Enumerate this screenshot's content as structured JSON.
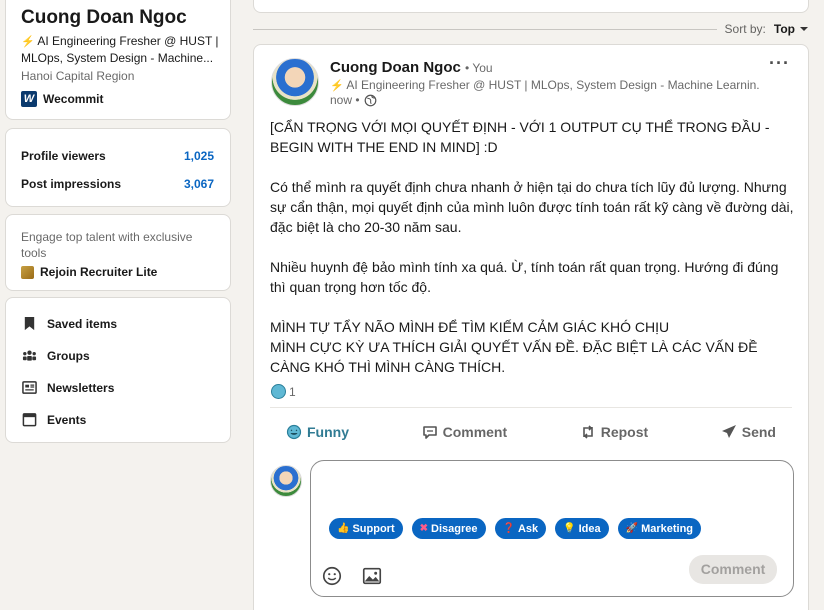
{
  "profile": {
    "name": "Cuong Doan Ngoc",
    "headline": "AI Engineering Fresher @ HUST | MLOps, System Design - Machine...",
    "location": "Hanoi Capital Region",
    "company": "Wecommit"
  },
  "stats": [
    {
      "label": "Profile viewers",
      "value": "1,025"
    },
    {
      "label": "Post impressions",
      "value": "3,067"
    }
  ],
  "promo": {
    "text": "Engage top talent with exclusive tools",
    "link": "Rejoin Recruiter Lite"
  },
  "nav": [
    {
      "label": "Saved items",
      "icon": "bookmark-icon"
    },
    {
      "label": "Groups",
      "icon": "groups-icon"
    },
    {
      "label": "Newsletters",
      "icon": "newsletter-icon"
    },
    {
      "label": "Events",
      "icon": "calendar-icon"
    }
  ],
  "sort": {
    "label": "Sort by:",
    "value": "Top"
  },
  "post": {
    "author": "Cuong Doan Ngoc",
    "you": "• You",
    "headline": "AI Engineering Fresher @ HUST | MLOps, System Design - Machine Learnin...",
    "time": "now •",
    "body": "[CẨN TRỌNG VỚI MỌI QUYẾT ĐỊNH - VỚI 1 OUTPUT CỤ THỂ TRONG ĐẦU - BEGIN WITH THE END IN MIND] :D\n\nCó thể mình ra quyết định chưa nhanh ở hiện tại do chưa tích lũy đủ lượng. Nhưng sự cẩn thận, mọi quyết định của mình luôn được tính toán rất kỹ càng về đường dài, đặc biệt là cho 20-30 năm sau.\n\nNhiều huynh đệ bảo mình tính xa quá. Ừ, tính toán rất quan trọng. Hướng đi đúng thì quan trọng hơn tốc độ.\n\nMÌNH TỰ TẨY NÃO MÌNH ĐỂ TÌM KIẾM CẢM GIÁC KHÓ CHỊU\nMÌNH CỰC KỲ ƯA THÍCH GIẢI QUYẾT VẤN ĐỀ. ĐẶC BIỆT LÀ CÁC VẤN ĐỀ CÀNG KHÓ THÌ MÌNH CÀNG THÍCH.",
    "reaction_count": "1"
  },
  "actions": {
    "funny": "Funny",
    "comment": "Comment",
    "repost": "Repost",
    "send": "Send"
  },
  "chips": [
    {
      "icon": "👍",
      "label": "Support"
    },
    {
      "icon": "✖",
      "label": "Disagree"
    },
    {
      "icon": "❓",
      "label": "Ask"
    },
    {
      "icon": "💡",
      "label": "Idea"
    },
    {
      "icon": "🚀",
      "label": "Marketing"
    }
  ],
  "comment_button": "Comment",
  "colors": {
    "accent": "#0a66c2",
    "funny": "#307b93",
    "background": "#f4f2ee"
  }
}
